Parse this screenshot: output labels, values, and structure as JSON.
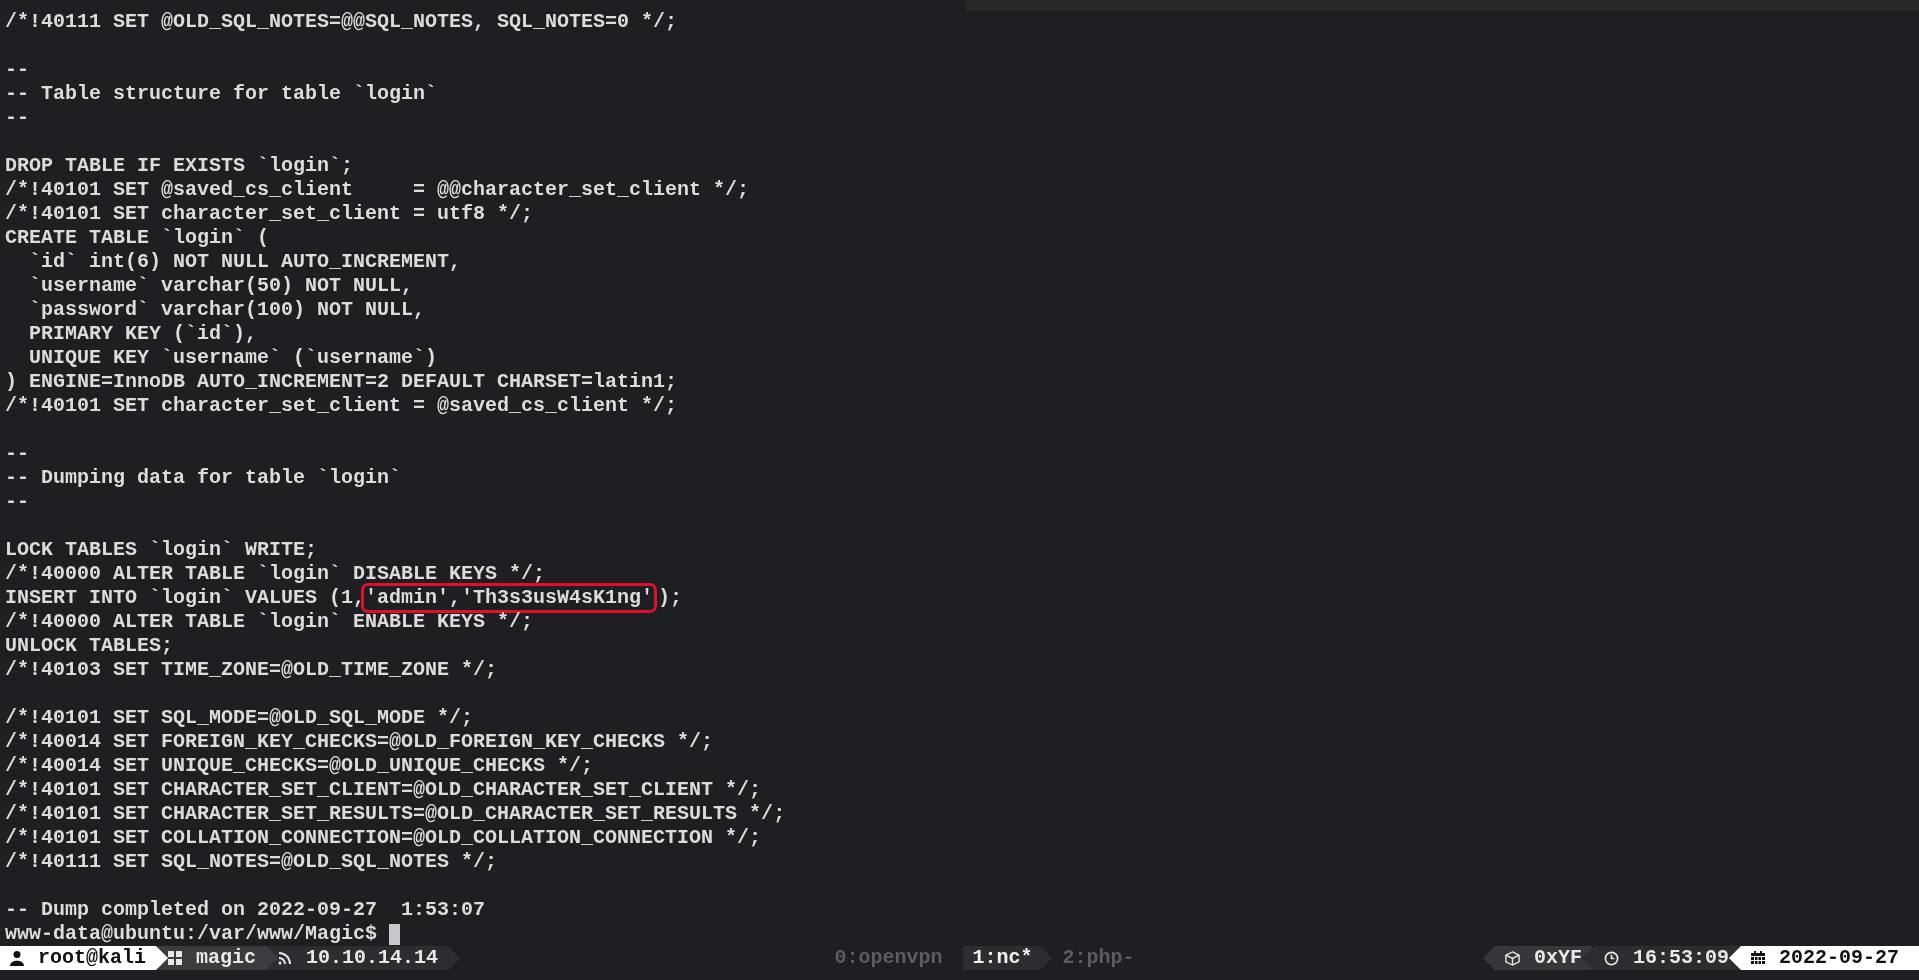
{
  "terminal": {
    "lines": [
      {
        "kind": "text",
        "text": "/*!40111 SET @OLD_SQL_NOTES=@@SQL_NOTES, SQL_NOTES=0 */;"
      },
      {
        "kind": "blank"
      },
      {
        "kind": "text",
        "text": "--"
      },
      {
        "kind": "text",
        "text": "-- Table structure for table `login`"
      },
      {
        "kind": "text",
        "text": "--"
      },
      {
        "kind": "blank"
      },
      {
        "kind": "text",
        "text": "DROP TABLE IF EXISTS `login`;"
      },
      {
        "kind": "text",
        "text": "/*!40101 SET @saved_cs_client     = @@character_set_client */;"
      },
      {
        "kind": "text",
        "text": "/*!40101 SET character_set_client = utf8 */;"
      },
      {
        "kind": "text",
        "text": "CREATE TABLE `login` ("
      },
      {
        "kind": "text",
        "text": "  `id` int(6) NOT NULL AUTO_INCREMENT,"
      },
      {
        "kind": "text",
        "text": "  `username` varchar(50) NOT NULL,"
      },
      {
        "kind": "text",
        "text": "  `password` varchar(100) NOT NULL,"
      },
      {
        "kind": "text",
        "text": "  PRIMARY KEY (`id`),"
      },
      {
        "kind": "text",
        "text": "  UNIQUE KEY `username` (`username`)"
      },
      {
        "kind": "text",
        "text": ") ENGINE=InnoDB AUTO_INCREMENT=2 DEFAULT CHARSET=latin1;"
      },
      {
        "kind": "text",
        "text": "/*!40101 SET character_set_client = @saved_cs_client */;"
      },
      {
        "kind": "blank"
      },
      {
        "kind": "text",
        "text": "--"
      },
      {
        "kind": "text",
        "text": "-- Dumping data for table `login`"
      },
      {
        "kind": "text",
        "text": "--"
      },
      {
        "kind": "blank"
      },
      {
        "kind": "text",
        "text": "LOCK TABLES `login` WRITE;"
      },
      {
        "kind": "text",
        "text": "/*!40000 ALTER TABLE `login` DISABLE KEYS */;"
      },
      {
        "kind": "highlight",
        "before": "INSERT INTO `login` VALUES (1,",
        "marked": "'admin','Th3s3usW4sK1ng'",
        "after": ");"
      },
      {
        "kind": "text",
        "text": "/*!40000 ALTER TABLE `login` ENABLE KEYS */;"
      },
      {
        "kind": "text",
        "text": "UNLOCK TABLES;"
      },
      {
        "kind": "text",
        "text": "/*!40103 SET TIME_ZONE=@OLD_TIME_ZONE */;"
      },
      {
        "kind": "blank"
      },
      {
        "kind": "text",
        "text": "/*!40101 SET SQL_MODE=@OLD_SQL_MODE */;"
      },
      {
        "kind": "text",
        "text": "/*!40014 SET FOREIGN_KEY_CHECKS=@OLD_FOREIGN_KEY_CHECKS */;"
      },
      {
        "kind": "text",
        "text": "/*!40014 SET UNIQUE_CHECKS=@OLD_UNIQUE_CHECKS */;"
      },
      {
        "kind": "text",
        "text": "/*!40101 SET CHARACTER_SET_CLIENT=@OLD_CHARACTER_SET_CLIENT */;"
      },
      {
        "kind": "text",
        "text": "/*!40101 SET CHARACTER_SET_RESULTS=@OLD_CHARACTER_SET_RESULTS */;"
      },
      {
        "kind": "text",
        "text": "/*!40101 SET COLLATION_CONNECTION=@OLD_COLLATION_CONNECTION */;"
      },
      {
        "kind": "text",
        "text": "/*!40111 SET SQL_NOTES=@OLD_SQL_NOTES */;"
      },
      {
        "kind": "blank"
      },
      {
        "kind": "text",
        "text": "-- Dump completed on 2022-09-27  1:53:07"
      },
      {
        "kind": "prompt",
        "text": "www-data@ubuntu:/var/www/Magic$"
      }
    ]
  },
  "status_bar": {
    "left": [
      {
        "kind": "user",
        "text": "root@kali"
      },
      {
        "kind": "grid",
        "text": "magic"
      },
      {
        "kind": "rss",
        "text": "10.10.14.14"
      }
    ],
    "windows": [
      {
        "label": "0:openvpn",
        "selected": false
      },
      {
        "label": "1:nc*",
        "selected": true
      },
      {
        "label": "2:php-",
        "selected": false
      }
    ],
    "right": [
      {
        "kind": "cube",
        "text": "0xYF"
      },
      {
        "kind": "clock",
        "text": "16:53:09"
      },
      {
        "kind": "calendar",
        "text": "2022-09-27"
      }
    ]
  }
}
